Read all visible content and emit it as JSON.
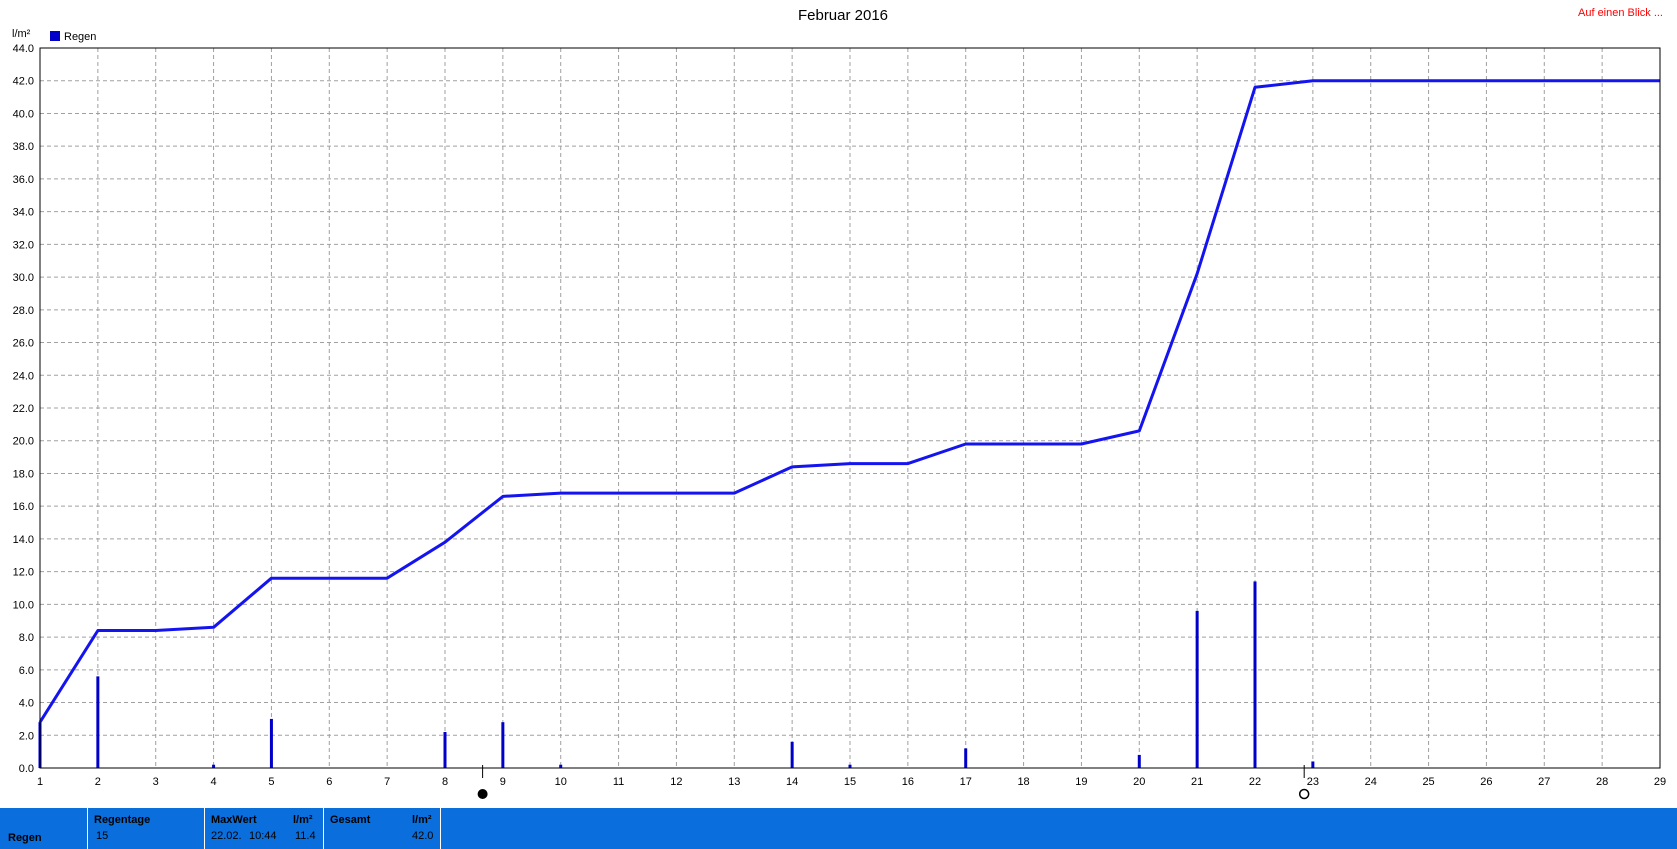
{
  "header": {
    "title": "Februar 2016",
    "link": "Auf einen Blick ...",
    "unit": "l/m²",
    "legend": "Regen"
  },
  "colors": {
    "series": "#1414f0",
    "bars": "#0000c8",
    "grid": "#a0a0a0",
    "link": "#ff0000",
    "statsbar": "#0a6fdc"
  },
  "chart_data": {
    "type": "line",
    "title": "Februar 2016",
    "ylabel": "l/m²",
    "xlabel": "",
    "xlim": [
      1,
      29
    ],
    "ylim": [
      0,
      44
    ],
    "grid": true,
    "legend_position": "top-left",
    "x_ticks": [
      "1",
      "2",
      "3",
      "4",
      "5",
      "6",
      "7",
      "8",
      "9",
      "10",
      "11",
      "12",
      "13",
      "14",
      "15",
      "16",
      "17",
      "18",
      "19",
      "20",
      "21",
      "22",
      "23",
      "24",
      "25",
      "26",
      "27",
      "28",
      "29"
    ],
    "y_ticks": [
      "0.0",
      "2.0",
      "4.0",
      "6.0",
      "8.0",
      "10.0",
      "12.0",
      "14.0",
      "16.0",
      "18.0",
      "20.0",
      "22.0",
      "24.0",
      "26.0",
      "28.0",
      "30.0",
      "32.0",
      "34.0",
      "36.0",
      "38.0",
      "40.0",
      "42.0",
      "44.0"
    ],
    "series": [
      {
        "name": "Regen",
        "kind": "cumulative-line",
        "points": [
          [
            1,
            2.8
          ],
          [
            2,
            8.4
          ],
          [
            3,
            8.4
          ],
          [
            4,
            8.6
          ],
          [
            5,
            11.6
          ],
          [
            6,
            11.6
          ],
          [
            7,
            11.6
          ],
          [
            8,
            13.8
          ],
          [
            9,
            16.6
          ],
          [
            10,
            16.8
          ],
          [
            11,
            16.8
          ],
          [
            12,
            16.8
          ],
          [
            13,
            16.8
          ],
          [
            14,
            18.4
          ],
          [
            15,
            18.6
          ],
          [
            16,
            18.6
          ],
          [
            17,
            19.8
          ],
          [
            18,
            19.8
          ],
          [
            19,
            19.8
          ],
          [
            20,
            20.6
          ],
          [
            21,
            30.2
          ],
          [
            22,
            41.6
          ],
          [
            23,
            42.0
          ],
          [
            29,
            42.0
          ]
        ]
      },
      {
        "kind": "daily-bars",
        "points": [
          [
            1,
            2.8
          ],
          [
            2,
            5.6
          ],
          [
            4,
            0.2
          ],
          [
            5,
            3.0
          ],
          [
            8,
            2.2
          ],
          [
            9,
            2.8
          ],
          [
            10,
            0.2
          ],
          [
            14,
            1.6
          ],
          [
            15,
            0.2
          ],
          [
            17,
            1.2
          ],
          [
            20,
            0.8
          ],
          [
            21,
            9.6
          ],
          [
            22,
            11.4
          ],
          [
            23,
            0.4
          ]
        ]
      }
    ],
    "moon_phases": [
      {
        "phase": "new-moon",
        "x": 8.65
      },
      {
        "phase": "full-moon",
        "x": 22.85
      }
    ]
  },
  "stats": {
    "row_label": "Regen",
    "regentage_label": "Regentage",
    "regentage_value": "15",
    "maxwert_label": "MaxWert",
    "maxwert_unit": "l/m²",
    "maxwert_date": "22.02.",
    "maxwert_time": "10:44",
    "maxwert_value": "11.4",
    "gesamt_label": "Gesamt",
    "gesamt_unit": "l/m²",
    "gesamt_value": "42.0"
  }
}
